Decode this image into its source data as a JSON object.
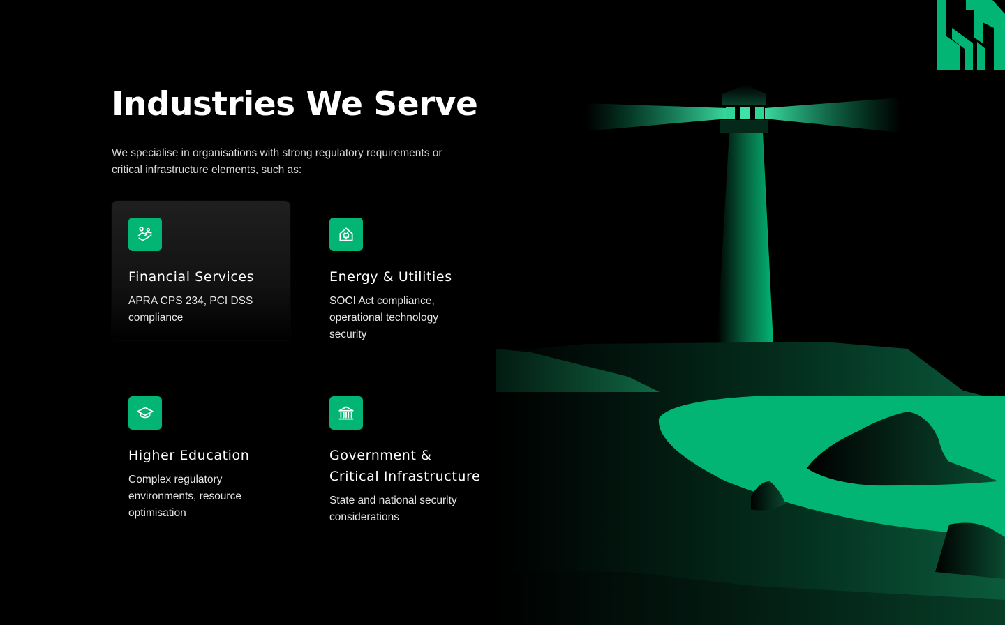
{
  "section": {
    "title": "Industries We Serve",
    "subtitle": "We specialise in organisations with strong regulatory requirements or critical infrastructure elements, such as:"
  },
  "industries": [
    {
      "icon": "handshake-icon",
      "title": "Financial Services",
      "description": "APRA CPS 234, PCI DSS compliance"
    },
    {
      "icon": "house-plug-icon",
      "title": "Energy & Utilities",
      "description": "SOCI Act compliance, operational technology security"
    },
    {
      "icon": "graduation-cap-icon",
      "title": "Higher Education",
      "description": "Complex regulatory environments, resource optimisation"
    },
    {
      "icon": "bank-building-icon",
      "title": "Government & Critical Infrastructure",
      "description": "State and national security considerations"
    }
  ],
  "colors": {
    "accent": "#03b574",
    "background": "#000000",
    "card_active": "#1a1a1a"
  }
}
